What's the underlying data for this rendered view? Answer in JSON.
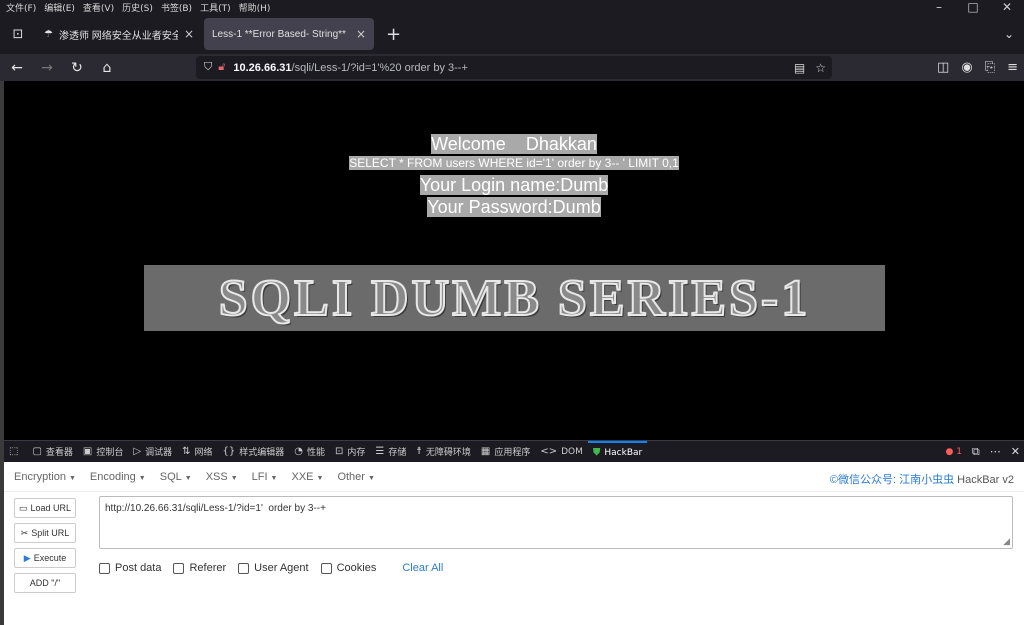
{
  "menubar": {
    "items": [
      "文件(F)",
      "编辑(E)",
      "查看(V)",
      "历史(S)",
      "书签(B)",
      "工具(T)",
      "帮助(H)"
    ],
    "controls": [
      "–",
      "□",
      "✕"
    ]
  },
  "tabs": {
    "tab1_title": "渗透师 网络安全从业者安全导航",
    "tab2_title": "Less-1 **Error Based- String**",
    "close": "×",
    "new_tab": "+"
  },
  "navbar": {
    "url_host": "10.26.66.31",
    "url_path": "/sqli/Less-1/?id=1'%20 order by 3--+"
  },
  "page": {
    "welcome": "Welcome    Dhakkan",
    "query": "SELECT * FROM users WHERE id='1' order by 3-- ' LIMIT 0,1",
    "login": "Your Login name:Dumb",
    "password": "Your Password:Dumb",
    "banner": "SQLI DUMB SERIES-1"
  },
  "devtools": {
    "tabs": [
      "查看器",
      "控制台",
      "调试器",
      "网络",
      "样式编辑器",
      "性能",
      "内存",
      "存储",
      "无障碍环境",
      "应用程序",
      "DOM",
      "HackBar"
    ],
    "error_count": "1",
    "active_color": "#0a84ff"
  },
  "hackbar": {
    "menu": [
      "Encryption",
      "Encoding",
      "SQL",
      "XSS",
      "LFI",
      "XXE",
      "Other"
    ],
    "brand_wechat": "©微信公众号: 江南小虫虫",
    "brand_name": " HackBar v2",
    "buttons": [
      "Load URL",
      "Split URL",
      "Execute",
      "ADD \"/\""
    ],
    "url_value": "http://10.26.66.31/sqli/Less-1/?id=1'  order by 3--+",
    "checks": [
      "Post data",
      "Referer",
      "User Agent",
      "Cookies"
    ],
    "clear_all": "Clear All"
  }
}
